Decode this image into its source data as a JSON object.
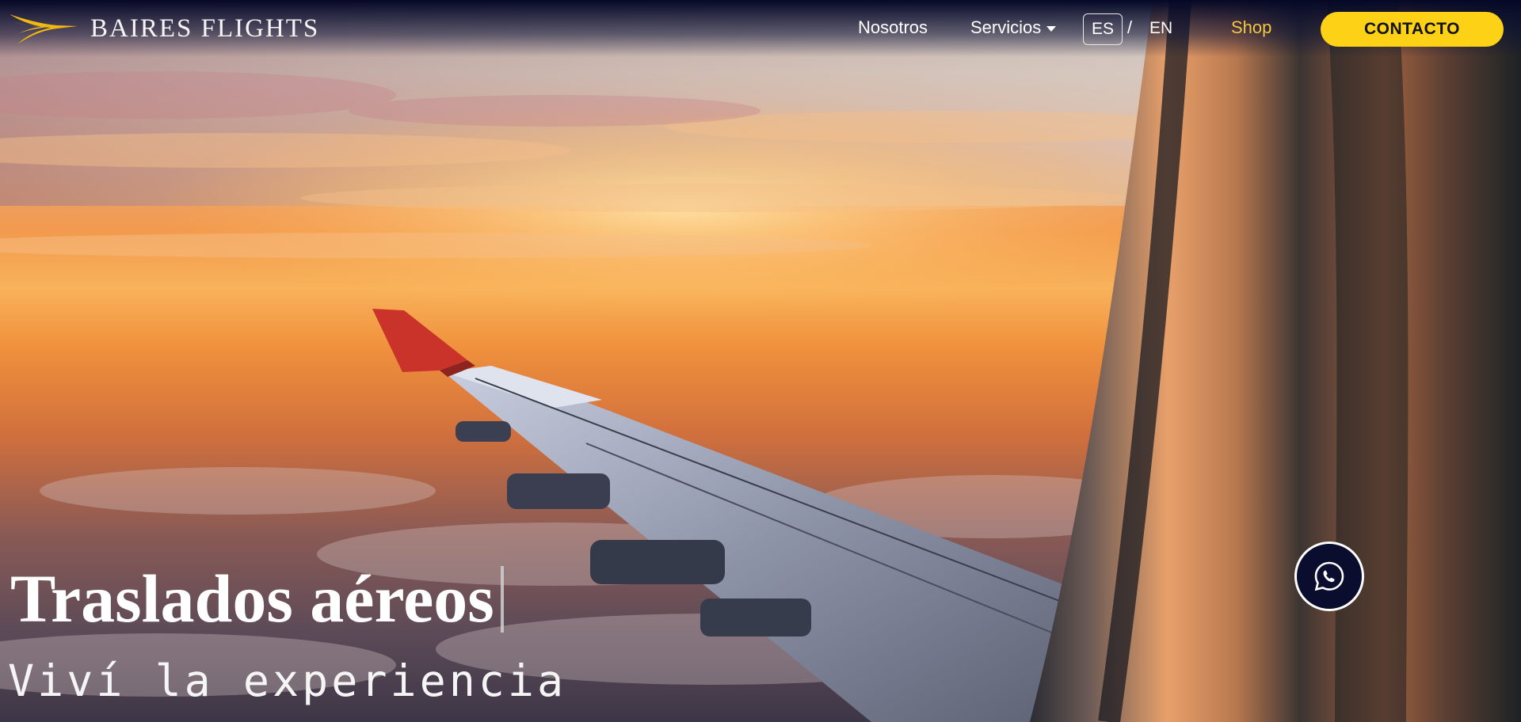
{
  "brand": {
    "name": "BAIRES FLIGHTS",
    "logo_icon": "plane-swoosh-icon"
  },
  "nav": {
    "items": [
      {
        "label": "Nosotros"
      },
      {
        "label": "Servicios"
      }
    ],
    "lang": {
      "es": "ES",
      "separator": "/",
      "en": "EN"
    },
    "shop": "Shop",
    "contact": "CONTACTO"
  },
  "hero": {
    "title": "Traslados aéreos",
    "subtitle": "Viví la experiencia"
  },
  "whatsapp": {
    "icon": "whatsapp-icon"
  },
  "colors": {
    "accent": "#fcd116",
    "shop": "#f4c542",
    "whatsapp_bg": "#0a0d2e",
    "nav_bg": "#070a24"
  }
}
